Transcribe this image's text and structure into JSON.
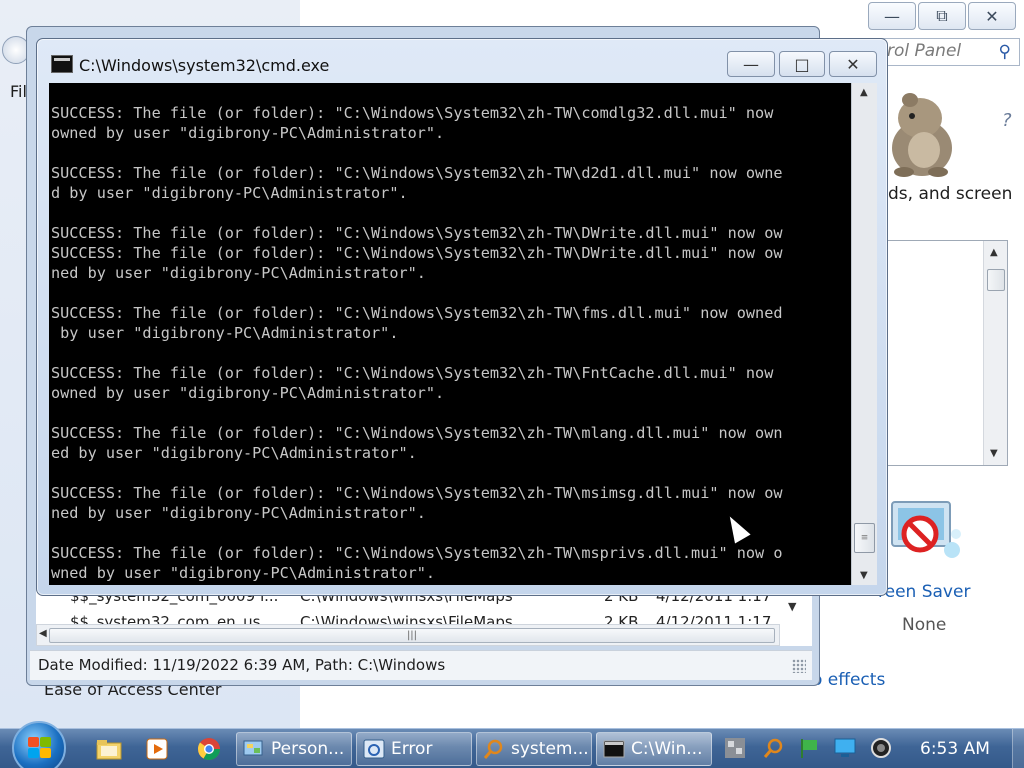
{
  "background_window": {
    "search_placeholder": "rol Panel",
    "menu_stub": "Fil",
    "description_fragment": "ds, and screen",
    "screen_saver_label": "reen Saver",
    "screen_saver_value": "None",
    "effects_label": "o effects",
    "ease_label": "Ease of Access Center",
    "help_glyph": "?"
  },
  "explorer": {
    "rows": [
      {
        "name": "$$_system32_com_0009 f...",
        "path": "C:\\Windows\\winsxs\\FileMaps",
        "size": "2 KB",
        "date": "4/12/2011 1:17"
      },
      {
        "name": "$$_system32_com_en_us...",
        "path": "C:\\Windows\\winsxs\\FileMaps",
        "size": "2 KB",
        "date": "4/12/2011 1:17"
      }
    ],
    "status": "Date Modified: 11/19/2022 6:39 AM, Path: C:\\Windows"
  },
  "cmd": {
    "title": "C:\\Windows\\system32\\cmd.exe",
    "lines": [
      "SUCCESS: The file (or folder): \"C:\\Windows\\System32\\zh-TW\\comdlg32.dll.mui\" now",
      "owned by user \"digibrony-PC\\Administrator\".",
      "",
      "SUCCESS: The file (or folder): \"C:\\Windows\\System32\\zh-TW\\d2d1.dll.mui\" now owne",
      "d by user \"digibrony-PC\\Administrator\".",
      "",
      "SUCCESS: The file (or folder): \"C:\\Windows\\System32\\zh-TW\\DWrite.dll.mui\" now ow",
      "SUCCESS: The file (or folder): \"C:\\Windows\\System32\\zh-TW\\DWrite.dll.mui\" now ow",
      "ned by user \"digibrony-PC\\Administrator\".",
      "",
      "SUCCESS: The file (or folder): \"C:\\Windows\\System32\\zh-TW\\fms.dll.mui\" now owned",
      " by user \"digibrony-PC\\Administrator\".",
      "",
      "SUCCESS: The file (or folder): \"C:\\Windows\\System32\\zh-TW\\FntCache.dll.mui\" now",
      "owned by user \"digibrony-PC\\Administrator\".",
      "",
      "SUCCESS: The file (or folder): \"C:\\Windows\\System32\\zh-TW\\mlang.dll.mui\" now own",
      "ed by user \"digibrony-PC\\Administrator\".",
      "",
      "SUCCESS: The file (or folder): \"C:\\Windows\\System32\\zh-TW\\msimsg.dll.mui\" now ow",
      "ned by user \"digibrony-PC\\Administrator\".",
      "",
      "SUCCESS: The file (or folder): \"C:\\Windows\\System32\\zh-TW\\msprivs.dll.mui\" now o",
      "wned by user \"digibrony-PC\\Administrator\"."
    ]
  },
  "taskbar": {
    "buttons": [
      {
        "label": "Person...",
        "icon": "personalization-icon"
      },
      {
        "label": "Error",
        "icon": "error-dialog-icon"
      },
      {
        "label": "system...",
        "icon": "search-results-icon"
      },
      {
        "label": "C:\\Win...",
        "icon": "cmd-icon",
        "active": true
      }
    ],
    "clock": "6:53 AM",
    "colors": {
      "taskbar": "#3f6596",
      "console_bg": "#000000",
      "console_fg": "#c7c7c7",
      "link": "#1a5fb4"
    }
  }
}
